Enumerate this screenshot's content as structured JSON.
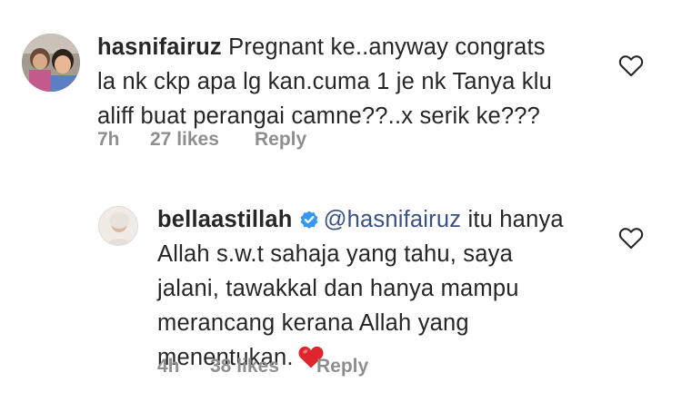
{
  "comments": [
    {
      "username": "hasnifairuz",
      "text_lines": [
        "Pregnant ke..anyway congrats",
        "la nk ckp apa lg kan.cuma 1 je nk Tanya klu",
        "aliff buat perangai camne??..x serik ke???"
      ],
      "time": "7h",
      "likes": "27 likes",
      "reply_label": "Reply",
      "like_icon": "heart-outline-icon"
    }
  ],
  "reply": {
    "username": "bellaastillah",
    "verified_icon": "verified-badge-icon",
    "mention": "@hasnifairuz",
    "first_line_rest": "itu hanya",
    "text_lines": [
      "Allah s.w.t sahaja yang tahu, saya",
      "jalani, tawakkal dan hanya mampu",
      "merancang kerana Allah yang",
      "menentukan."
    ],
    "emoji": "red-heart-emoji",
    "time": "4h",
    "likes": "38 likes",
    "reply_label": "Reply",
    "like_icon": "heart-outline-icon"
  },
  "colors": {
    "text": "#262626",
    "secondary": "#8e8e8e",
    "link": "#385185",
    "verified": "#3897f0",
    "emoji_heart": "#e0242c"
  }
}
